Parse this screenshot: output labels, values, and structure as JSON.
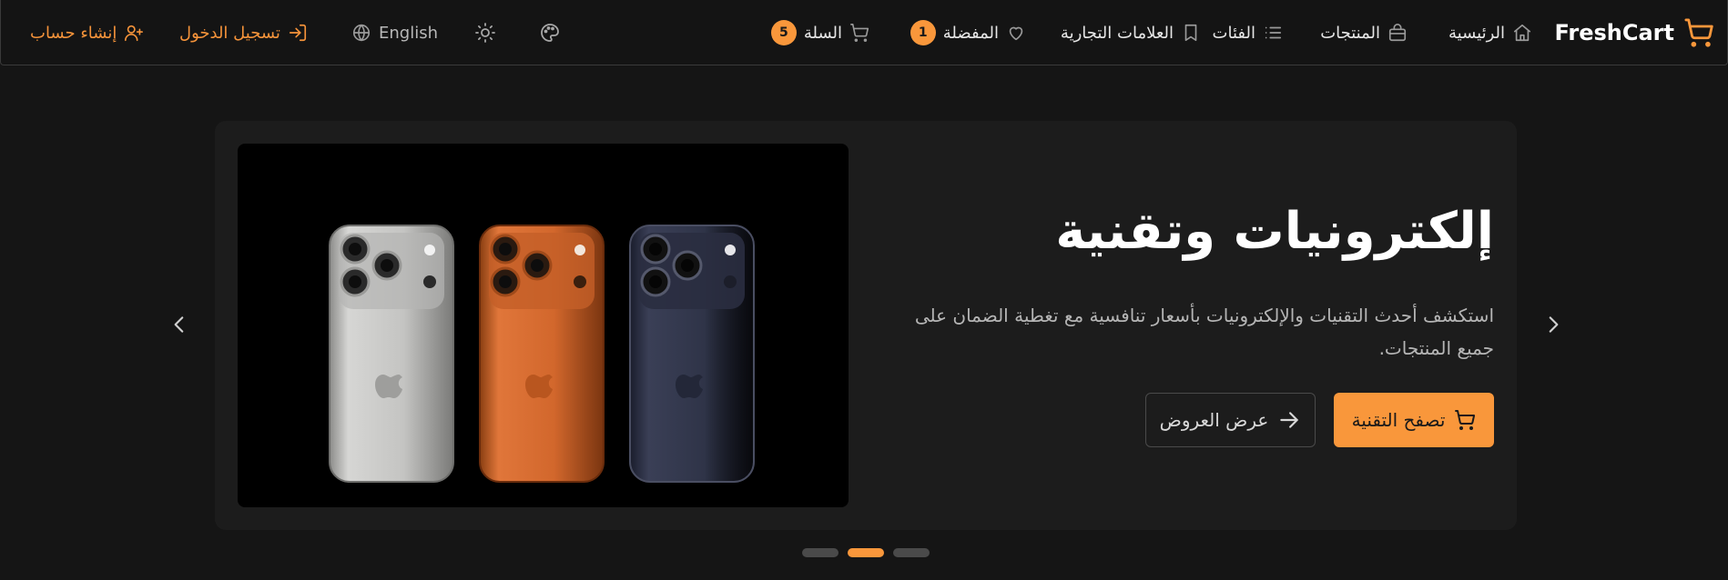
{
  "nav": {
    "brand": "FreshCart",
    "home": "الرئيسية",
    "products": "المنتجات",
    "categories": "الفئات",
    "brands": "العلامات التجارية",
    "wishlist": {
      "label": "المفضلة",
      "count": "1"
    },
    "cart": {
      "label": "السلة",
      "count": "5"
    },
    "language": "English",
    "login": "تسجيل الدخول",
    "register": "إنشاء حساب"
  },
  "hero": {
    "title": "إلكترونيات وتقنية",
    "description": "استكشف أحدث التقنيات والإلكترونيات بأسعار تنافسية مع تغطية الضمان على جميع المنتجات.",
    "primary_button": "تصفح التقنية",
    "secondary_button": "عرض العروض"
  },
  "carousel": {
    "slide_count": 3,
    "active_index": 1
  },
  "colors": {
    "accent": "#f9973b",
    "background": "#151515",
    "card": "#1c1c1c"
  },
  "icons": {
    "brand": "cart-icon",
    "home": "home-icon",
    "products": "shopping-bag-icon",
    "categories": "list-icon",
    "brands": "bookmark-icon",
    "wishlist": "heart-icon",
    "cart": "cart-icon",
    "theme": "sun-icon",
    "palette": "palette-icon",
    "language": "globe-icon",
    "login": "login-icon",
    "register": "user-plus-icon"
  }
}
